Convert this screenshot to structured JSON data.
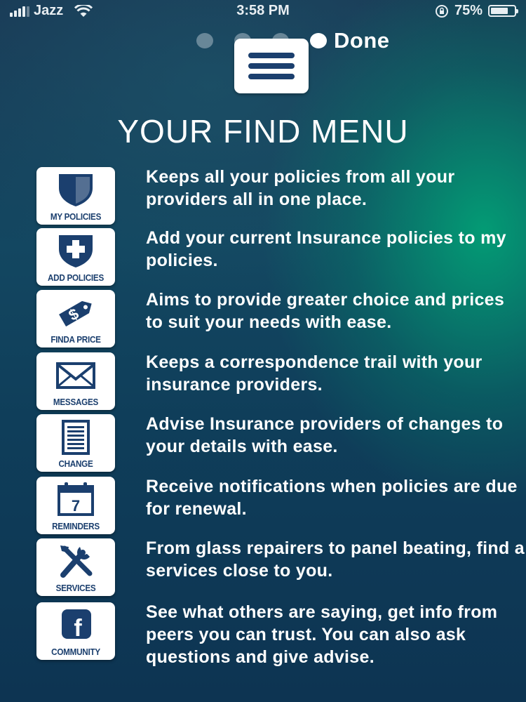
{
  "status": {
    "carrier": "Jazz",
    "time": "3:58 PM",
    "battery": "75%",
    "battery_level": 0.75
  },
  "pager": {
    "done_label": "Done",
    "dot_count": 4,
    "active_index": 3
  },
  "page_title": "YOUR FIND MENU",
  "menu_items": [
    {
      "label": "MY POLICIES",
      "icon": "shield-icon",
      "description": "Keeps all your policies from all your providers all in one place."
    },
    {
      "label": "ADD POLICIES",
      "icon": "shield-plus-icon",
      "description": "Add your current Insurance policies to my policies."
    },
    {
      "label": "FINDA PRICE",
      "icon": "price-tag-icon",
      "description": "Aims to provide greater choice and prices to suit your needs with ease."
    },
    {
      "label": "MESSAGES",
      "icon": "envelope-icon",
      "description": "Keeps a correspondence trail with your insurance providers."
    },
    {
      "label": "CHANGE",
      "icon": "document-icon",
      "description": "Advise Insurance providers of changes to your details with ease."
    },
    {
      "label": "REMINDERS",
      "icon": "calendar-icon",
      "calendar_day": "7",
      "description": "Receive notifications when policies are due for renewal."
    },
    {
      "label": "SERVICES",
      "icon": "tools-icon",
      "description": "From glass repairers to panel beating, find a services close to you."
    },
    {
      "label": "COMMUNITY",
      "icon": "facebook-icon",
      "facebook_letter": "f",
      "description": "See what others are saying, get info from peers you can trust. You can also ask questions and give advise."
    }
  ],
  "colors": {
    "icon_blue": "#1b3f6e",
    "tile_bg": "#ffffff",
    "text": "#ffffff"
  }
}
